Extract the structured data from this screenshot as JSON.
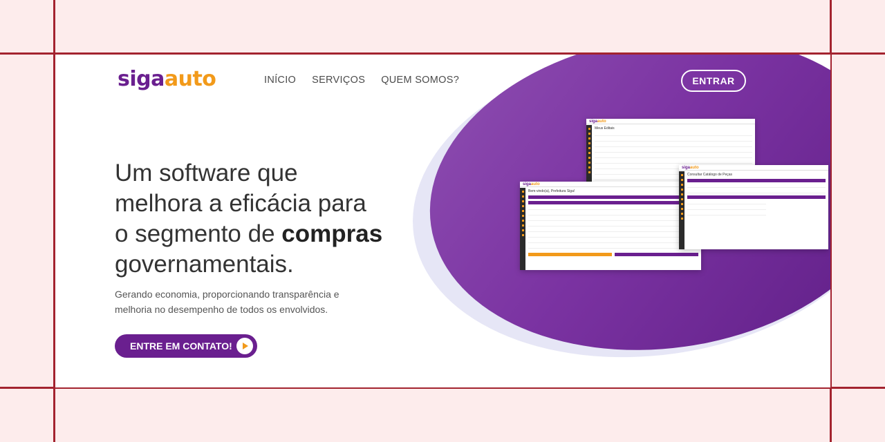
{
  "brand": {
    "logo_part1": "siga",
    "logo_part2": "auto",
    "purple": "#6a1f8f",
    "orange": "#f29a1a"
  },
  "nav": {
    "items": [
      "INÍCIO",
      "SERVIÇOS",
      "QUEM SOMOS?"
    ]
  },
  "header": {
    "login_label": "ENTRAR"
  },
  "hero": {
    "headline_line1": "Um software que",
    "headline_line2": "melhora a eficácia para",
    "headline_line3_prefix": "o segmento de ",
    "headline_line3_bold": "compras",
    "headline_line4": "governamentais.",
    "subtitle": "Gerando economia, proporcionando transparência e melhoria no desempenho de todos os envolvidos.",
    "cta_label": "ENTRE EM CONTATO!"
  },
  "preview": {
    "screen1_title": "Meus Editais",
    "screen2_title": "Bem-vindo(a), Prefeitura Siga!",
    "screen3_title": "Consultar Catálogo de Peças"
  }
}
